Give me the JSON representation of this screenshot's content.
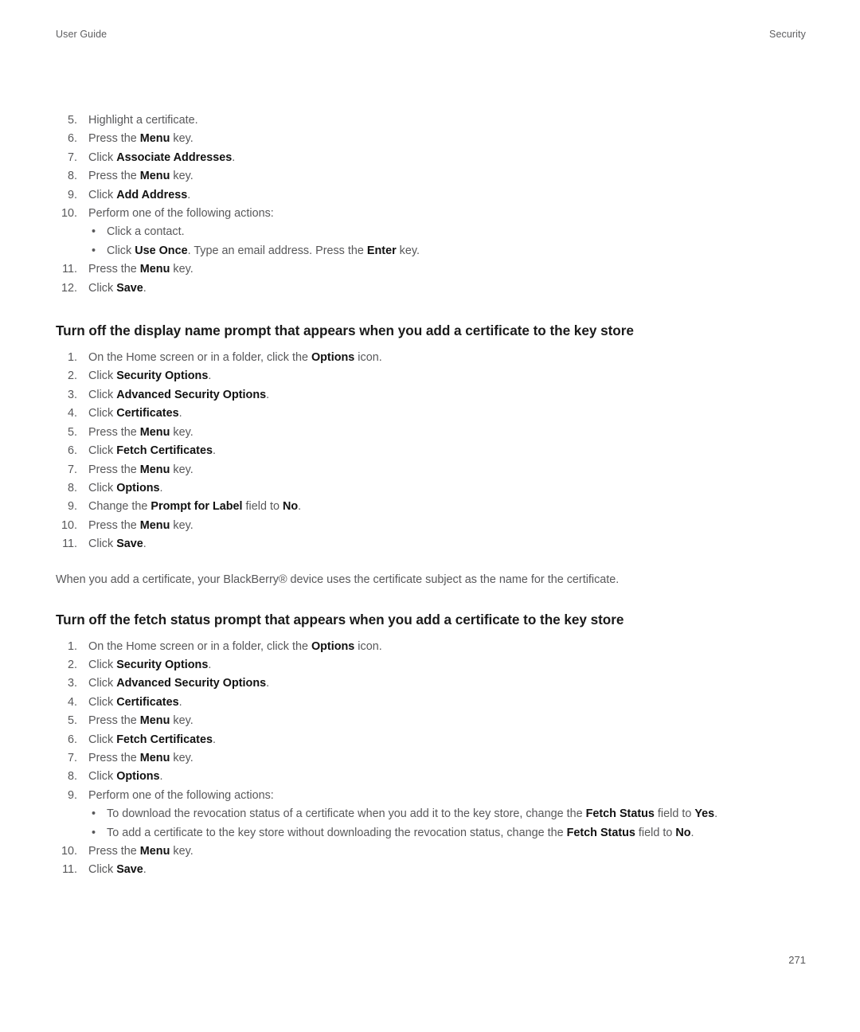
{
  "header": {
    "left": "User Guide",
    "right": "Security"
  },
  "footer": {
    "page_number": "271"
  },
  "list1": {
    "items": [
      {
        "num": "5.",
        "html": "Highlight a certificate."
      },
      {
        "num": "6.",
        "html": "Press the <b>Menu</b> key."
      },
      {
        "num": "7.",
        "html": "Click <b>Associate Addresses</b>."
      },
      {
        "num": "8.",
        "html": "Press the <b>Menu</b> key."
      },
      {
        "num": "9.",
        "html": "Click <b>Add Address</b>."
      },
      {
        "num": "10.",
        "html": "Perform one of the following actions:",
        "sub": [
          {
            "marker": "•",
            "html": "Click a contact."
          },
          {
            "marker": "•",
            "html": "Click <b>Use Once</b>. Type an email address. Press the <b>Enter</b> key."
          }
        ]
      },
      {
        "num": "11.",
        "html": "Press the <b>Menu</b> key."
      },
      {
        "num": "12.",
        "html": "Click <b>Save</b>."
      }
    ]
  },
  "section1": {
    "heading": "Turn off the display name prompt that appears when you add a certificate to the key store",
    "items": [
      {
        "num": "1.",
        "html": "On the Home screen or in a folder, click the <b>Options</b> icon."
      },
      {
        "num": "2.",
        "html": "Click <b>Security Options</b>."
      },
      {
        "num": "3.",
        "html": "Click <b>Advanced Security Options</b>."
      },
      {
        "num": "4.",
        "html": "Click <b>Certificates</b>."
      },
      {
        "num": "5.",
        "html": "Press the <b>Menu</b> key."
      },
      {
        "num": "6.",
        "html": "Click <b>Fetch Certificates</b>."
      },
      {
        "num": "7.",
        "html": "Press the <b>Menu</b> key."
      },
      {
        "num": "8.",
        "html": "Click <b>Options</b>."
      },
      {
        "num": "9.",
        "html": "Change the <b>Prompt for Label</b> field to <b>No</b>."
      },
      {
        "num": "10.",
        "html": "Press the <b>Menu</b> key."
      },
      {
        "num": "11.",
        "html": "Click <b>Save</b>."
      }
    ],
    "paragraph": "When you add a certificate, your BlackBerry® device uses the certificate subject as the name for the certificate."
  },
  "section2": {
    "heading": "Turn off the fetch status prompt that appears when you add a certificate to the key store",
    "items": [
      {
        "num": "1.",
        "html": "On the Home screen or in a folder, click the <b>Options</b> icon."
      },
      {
        "num": "2.",
        "html": "Click <b>Security Options</b>."
      },
      {
        "num": "3.",
        "html": "Click <b>Advanced Security Options</b>."
      },
      {
        "num": "4.",
        "html": "Click <b>Certificates</b>."
      },
      {
        "num": "5.",
        "html": "Press the <b>Menu</b> key."
      },
      {
        "num": "6.",
        "html": "Click <b>Fetch Certificates</b>."
      },
      {
        "num": "7.",
        "html": "Press the <b>Menu</b> key."
      },
      {
        "num": "8.",
        "html": "Click <b>Options</b>."
      },
      {
        "num": "9.",
        "html": "Perform one of the following actions:",
        "sub": [
          {
            "marker": "•",
            "html": "To download the revocation status of a certificate when you add it to the key store, change the <b>Fetch Status</b> field to <b>Yes</b>."
          },
          {
            "marker": "•",
            "html": "To add a certificate to the key store without downloading the revocation status, change the <b>Fetch Status</b> field to <b>No</b>."
          }
        ]
      },
      {
        "num": "10.",
        "html": "Press the <b>Menu</b> key."
      },
      {
        "num": "11.",
        "html": "Click <b>Save</b>."
      }
    ]
  },
  "colors": {
    "body_text": "#58585a",
    "bold_text": "#111111",
    "heading": "#1a1a1a",
    "page_background": "#ffffff"
  }
}
